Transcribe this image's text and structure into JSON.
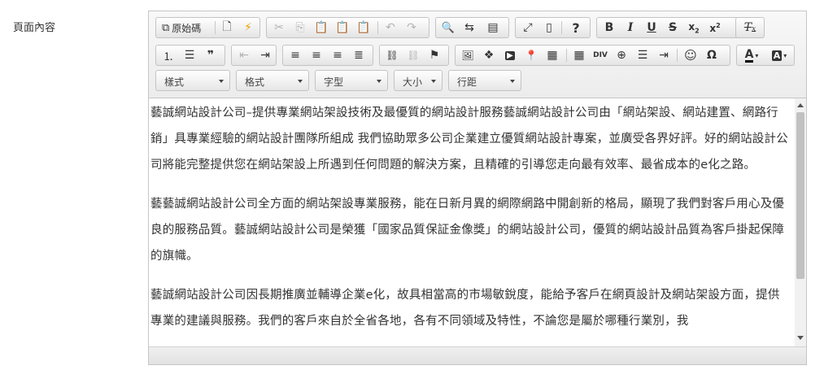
{
  "field_label": "頁面內容",
  "toolbar": {
    "row1": [
      {
        "name": "source-button",
        "icon": "source-icon",
        "glyph": "⧉",
        "label": "原始碼",
        "enabled": true
      },
      {
        "name": "new-page-button",
        "icon": "new-page-icon",
        "glyph": "🗋",
        "enabled": true
      },
      {
        "name": "templates-button",
        "icon": "templates-icon",
        "glyph": "⚡",
        "enabled": true
      },
      {
        "name": "cut-button",
        "icon": "scissors-icon",
        "glyph": "✂",
        "enabled": false
      },
      {
        "name": "copy-button",
        "icon": "copy-icon",
        "glyph": "⎘",
        "enabled": false
      },
      {
        "name": "paste-button",
        "icon": "paste-icon",
        "glyph": "📋",
        "enabled": true
      },
      {
        "name": "paste-text-button",
        "icon": "paste-text-icon",
        "glyph": "📋",
        "enabled": true
      },
      {
        "name": "paste-word-button",
        "icon": "paste-word-icon",
        "glyph": "📋",
        "enabled": true
      },
      {
        "name": "undo-button",
        "icon": "undo-icon",
        "glyph": "↶",
        "enabled": false
      },
      {
        "name": "redo-button",
        "icon": "redo-icon",
        "glyph": "↷",
        "enabled": false
      },
      {
        "name": "find-button",
        "icon": "search-icon",
        "glyph": "🔍",
        "enabled": true
      },
      {
        "name": "replace-button",
        "icon": "replace-icon",
        "glyph": "⇆",
        "enabled": true
      },
      {
        "name": "select-all-button",
        "icon": "select-all-icon",
        "glyph": "▤",
        "enabled": true
      },
      {
        "name": "maximize-button",
        "icon": "maximize-icon",
        "glyph": "⤢",
        "enabled": true
      },
      {
        "name": "show-blocks-button",
        "icon": "show-blocks-icon",
        "glyph": "▯",
        "enabled": true
      },
      {
        "name": "help-button",
        "icon": "help-icon",
        "glyph": "?",
        "enabled": true
      },
      {
        "name": "bold-button",
        "icon": "bold-icon",
        "glyph": "B",
        "enabled": true
      },
      {
        "name": "italic-button",
        "icon": "italic-icon",
        "glyph": "I",
        "enabled": true
      },
      {
        "name": "underline-button",
        "icon": "underline-icon",
        "glyph": "U",
        "enabled": true
      },
      {
        "name": "strike-button",
        "icon": "strikethrough-icon",
        "glyph": "S",
        "enabled": true
      },
      {
        "name": "subscript-button",
        "icon": "subscript-icon",
        "glyph": "x₂",
        "enabled": true
      },
      {
        "name": "superscript-button",
        "icon": "superscript-icon",
        "glyph": "x²",
        "enabled": true
      },
      {
        "name": "remove-format-button",
        "icon": "remove-format-icon",
        "glyph": "Tx",
        "enabled": true
      }
    ],
    "row2": [
      {
        "name": "numbered-list-button",
        "icon": "numbered-list-icon",
        "glyph": "⒈"
      },
      {
        "name": "bulleted-list-button",
        "icon": "bulleted-list-icon",
        "glyph": "☰"
      },
      {
        "name": "blockquote-button",
        "icon": "quote-icon",
        "glyph": "❞"
      },
      {
        "name": "outdent-button",
        "icon": "outdent-icon",
        "glyph": "⇤",
        "enabled": false
      },
      {
        "name": "indent-button",
        "icon": "indent-icon",
        "glyph": "⇥"
      },
      {
        "name": "align-left-button",
        "icon": "align-left-icon",
        "glyph": "≡"
      },
      {
        "name": "align-center-button",
        "icon": "align-center-icon",
        "glyph": "≡"
      },
      {
        "name": "align-right-button",
        "icon": "align-right-icon",
        "glyph": "≡"
      },
      {
        "name": "justify-button",
        "icon": "justify-icon",
        "glyph": "≣"
      },
      {
        "name": "link-button",
        "icon": "link-icon",
        "glyph": "⛓"
      },
      {
        "name": "unlink-button",
        "icon": "unlink-icon",
        "glyph": "⛓",
        "enabled": false
      },
      {
        "name": "anchor-button",
        "icon": "flag-icon",
        "glyph": "⚑"
      },
      {
        "name": "image-button",
        "icon": "image-icon",
        "glyph": "🖼"
      },
      {
        "name": "flash-button",
        "icon": "flash-icon",
        "glyph": "❖"
      },
      {
        "name": "youtube-button",
        "icon": "youtube-icon",
        "glyph": "▶"
      },
      {
        "name": "map-button",
        "icon": "map-pin-icon",
        "glyph": "📍"
      },
      {
        "name": "qrcode-button",
        "icon": "qrcode-icon",
        "glyph": "▦"
      },
      {
        "name": "table-button",
        "icon": "table-icon",
        "glyph": "▦"
      },
      {
        "name": "div-button",
        "icon": "div-icon",
        "glyph": "⊞"
      },
      {
        "name": "iframe-button",
        "icon": "globe-icon",
        "glyph": "⊕"
      },
      {
        "name": "horizontal-rule-button",
        "icon": "horizontal-rule-icon",
        "glyph": "☰"
      },
      {
        "name": "page-break-button",
        "icon": "page-break-icon",
        "glyph": "⇥"
      },
      {
        "name": "smiley-button",
        "icon": "smiley-icon",
        "glyph": "☺"
      },
      {
        "name": "special-char-button",
        "icon": "omega-icon",
        "glyph": "Ω"
      },
      {
        "name": "text-color-button",
        "icon": "text-color-icon",
        "glyph": "A"
      },
      {
        "name": "bg-color-button",
        "icon": "bg-color-icon",
        "glyph": "A"
      }
    ],
    "combos": [
      {
        "name": "styles-combo",
        "label": "樣式"
      },
      {
        "name": "format-combo",
        "label": "格式"
      },
      {
        "name": "font-combo",
        "label": "字型"
      },
      {
        "name": "size-combo",
        "label": "大小"
      },
      {
        "name": "line-height-combo",
        "label": "行距"
      }
    ]
  },
  "content": {
    "paragraphs": [
      "藝誠網站設計公司–提供專業網站架設技術及最優質的網站設計服務藝誠網站設計公司由「網站架設、網站建置、網路行銷」具專業經驗的網站設計團隊所組成 我們協助眾多公司企業建立優質網站設計專案，並廣受各界好評。好的網站設計公司將能完整提供您在網站架設上所遇到任何問題的解決方案，且精確的引導您走向最有效率、最省成本的e化之路。",
      "藝藝誠網站設計公司全方面的網站架設專業服務，能在日新月異的網際網路中開創新的格局，顯現了我們對客戶用心及優良的服務品質。藝誠網站設計公司是榮獲「國家品質保証金像獎」的網站設計公司，優質的網站設計品質為客戶掛起保障的旗幟。",
      "藝誠網站設計公司因長期推廣並輔導企業e化，故具相當高的市場敏銳度，能給予客戶在網頁設計及網站架設方面，提供專業的建議與服務。我們的客戶來自於全省各地，各有不同領域及特性，不論您是屬於哪種行業別，我"
    ]
  }
}
